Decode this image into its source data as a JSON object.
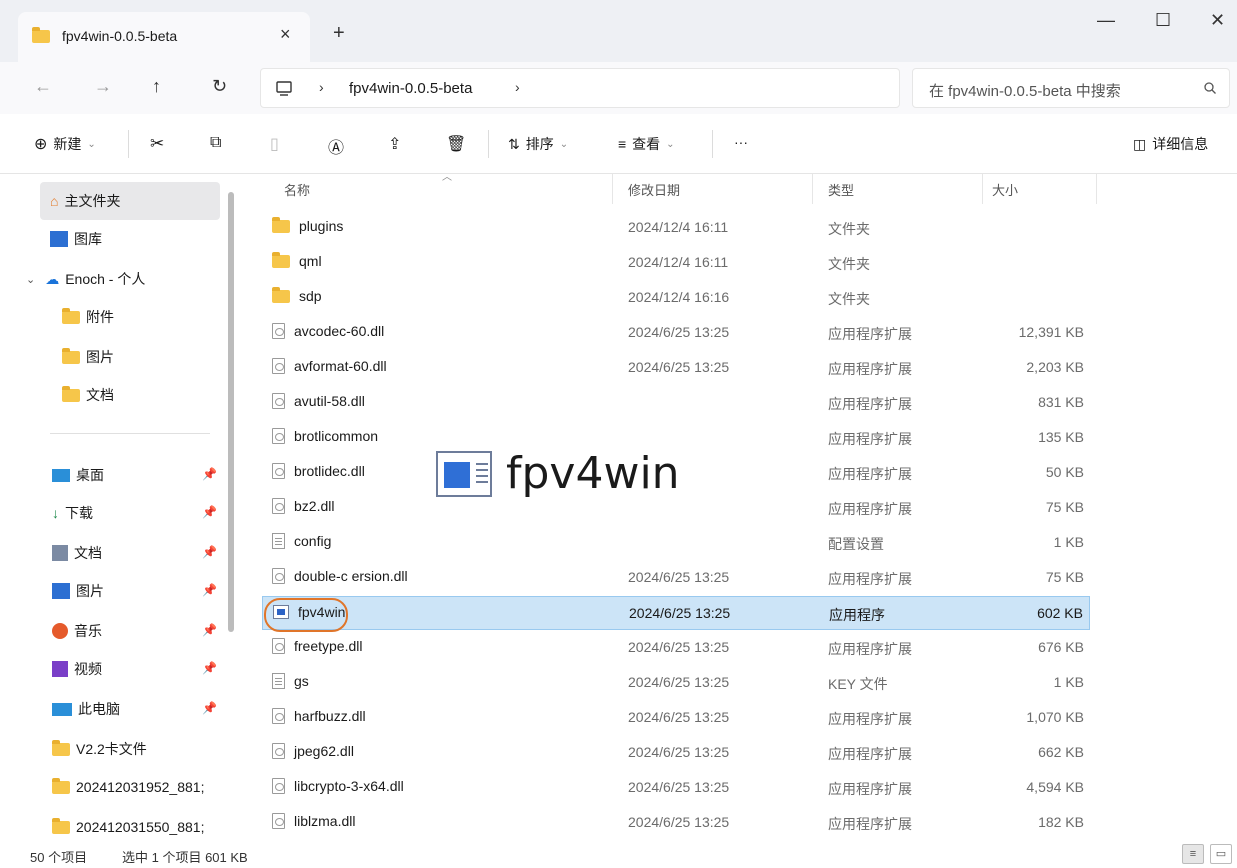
{
  "window": {
    "tab_title": "fpv4win-0.0.5-beta",
    "tab_close": "×",
    "new_tab": "+",
    "minimize": "—",
    "maximize": "☐",
    "close": "✕"
  },
  "address": {
    "breadcrumb": "fpv4win-0.0.5-beta",
    "search_placeholder": "在 fpv4win-0.0.5-beta 中搜索"
  },
  "commands": {
    "new_label": "新建",
    "sort_label": "排序",
    "view_label": "查看",
    "more_label": "···",
    "details_label": "详细信息"
  },
  "sidebar": {
    "home": "主文件夹",
    "gallery": "图库",
    "onedrive": "Enoch - 个人",
    "od_items": [
      "附件",
      "图片",
      "文档"
    ],
    "pinned": [
      "桌面",
      "下载",
      "文档",
      "图片",
      "音乐",
      "视频",
      "此电脑",
      "V2.2卡文件",
      "202412031952_881;",
      "202412031550_881;"
    ]
  },
  "columns": {
    "name": "名称",
    "date": "修改日期",
    "type": "类型",
    "size": "大小"
  },
  "files": [
    {
      "name": "plugins",
      "date": "2024/12/4 16:11",
      "type": "文件夹",
      "size": "",
      "kind": "folder"
    },
    {
      "name": "qml",
      "date": "2024/12/4 16:11",
      "type": "文件夹",
      "size": "",
      "kind": "folder"
    },
    {
      "name": "sdp",
      "date": "2024/12/4 16:16",
      "type": "文件夹",
      "size": "",
      "kind": "folder"
    },
    {
      "name": "avcodec-60.dll",
      "date": "2024/6/25 13:25",
      "type": "应用程序扩展",
      "size": "12,391 KB",
      "kind": "dll"
    },
    {
      "name": "avformat-60.dll",
      "date": "2024/6/25 13:25",
      "type": "应用程序扩展",
      "size": "2,203 KB",
      "kind": "dll"
    },
    {
      "name": "avutil-58.dll",
      "date": "",
      "type": "应用程序扩展",
      "size": "831 KB",
      "kind": "dll"
    },
    {
      "name": "brotlicommon",
      "date": "",
      "type": "应用程序扩展",
      "size": "135 KB",
      "kind": "dll"
    },
    {
      "name": "brotlidec.dll",
      "date": "",
      "type": "应用程序扩展",
      "size": "50 KB",
      "kind": "dll"
    },
    {
      "name": "bz2.dll",
      "date": "",
      "type": "应用程序扩展",
      "size": "75 KB",
      "kind": "dll"
    },
    {
      "name": "config",
      "date": "",
      "type": "配置设置",
      "size": "1 KB",
      "kind": "txt"
    },
    {
      "name": "double-c  ersion.dll",
      "date": "2024/6/25 13:25",
      "type": "应用程序扩展",
      "size": "75 KB",
      "kind": "dll"
    },
    {
      "name": "fpv4win",
      "date": "2024/6/25 13:25",
      "type": "应用程序",
      "size": "602 KB",
      "kind": "exe",
      "selected": true
    },
    {
      "name": "freetype.dll",
      "date": "2024/6/25 13:25",
      "type": "应用程序扩展",
      "size": "676 KB",
      "kind": "dll"
    },
    {
      "name": "gs",
      "date": "2024/6/25 13:25",
      "type": "KEY 文件",
      "size": "1 KB",
      "kind": "txt"
    },
    {
      "name": "harfbuzz.dll",
      "date": "2024/6/25 13:25",
      "type": "应用程序扩展",
      "size": "1,070 KB",
      "kind": "dll"
    },
    {
      "name": "jpeg62.dll",
      "date": "2024/6/25 13:25",
      "type": "应用程序扩展",
      "size": "662 KB",
      "kind": "dll"
    },
    {
      "name": "libcrypto-3-x64.dll",
      "date": "2024/6/25 13:25",
      "type": "应用程序扩展",
      "size": "4,594 KB",
      "kind": "dll"
    },
    {
      "name": "liblzma.dll",
      "date": "2024/6/25 13:25",
      "type": "应用程序扩展",
      "size": "182 KB",
      "kind": "dll"
    }
  ],
  "splash": {
    "title": "fpv4win"
  },
  "status": {
    "count": "50 个项目",
    "selected": "选中 1 个项目  601 KB"
  }
}
